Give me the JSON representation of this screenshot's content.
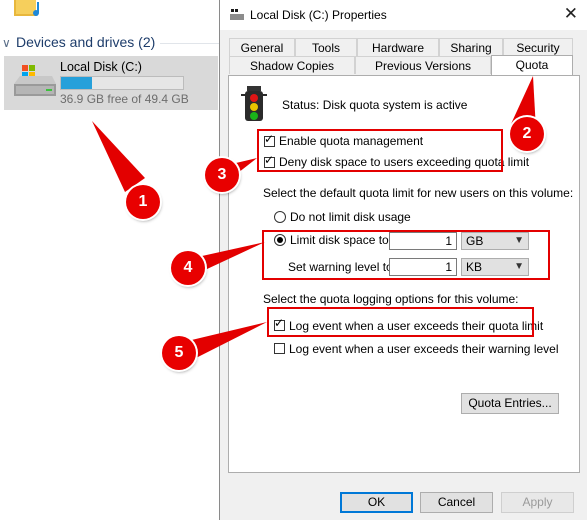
{
  "explorer": {
    "group_header": "Devices and drives (2)",
    "drive": {
      "name": "Local Disk (C:)",
      "free_text": "36.9 GB free of 49.4 GB",
      "used_fraction": 0.25
    }
  },
  "dialog": {
    "title": "Local Disk (C:) Properties",
    "close_glyph": "✕",
    "tabs_row1": [
      "General",
      "Tools",
      "Hardware",
      "Sharing",
      "Security"
    ],
    "tabs_row2": [
      "Shadow Copies",
      "Previous Versions",
      "Quota"
    ],
    "active_tab": "Quota",
    "status": "Status:  Disk quota system is active",
    "enable_quota": {
      "label": "Enable quota management",
      "checked": true
    },
    "deny_space": {
      "label": "Deny disk space to users exceeding quota limit",
      "checked": true
    },
    "default_limit_heading": "Select the default quota limit for new users on this volume:",
    "no_limit": {
      "label": "Do not limit disk usage",
      "selected": false
    },
    "limit": {
      "label": "Limit disk space to",
      "selected": true,
      "value": "1",
      "unit": "GB"
    },
    "warning": {
      "label": "Set warning level to",
      "value": "1",
      "unit": "KB"
    },
    "logging_heading": "Select the quota logging options for this volume:",
    "log_limit": {
      "label": "Log event when a user exceeds their quota limit",
      "checked": true
    },
    "log_warning": {
      "label": "Log event when a user exceeds their warning level",
      "checked": false
    },
    "quota_entries_button": "Quota Entries...",
    "ok_button": "OK",
    "cancel_button": "Cancel",
    "apply_button": "Apply"
  },
  "annotations": {
    "badge_1": "1",
    "badge_2": "2",
    "badge_3": "3",
    "badge_4": "4",
    "badge_5": "5",
    "accent_color": "#e30000"
  }
}
